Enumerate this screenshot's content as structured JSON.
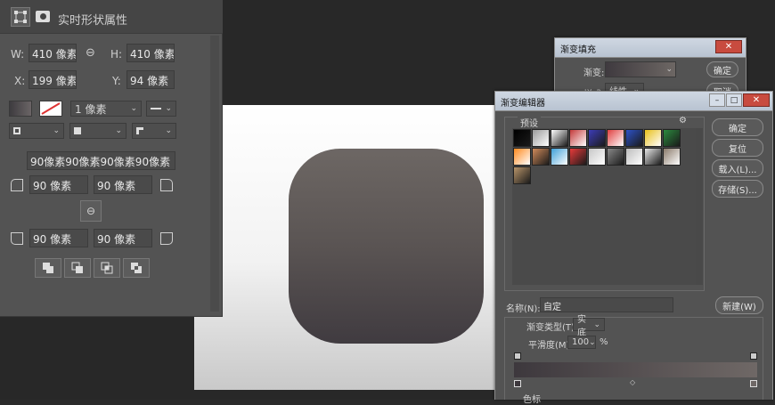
{
  "properties_panel": {
    "title": "实时形状属性",
    "w_label": "W:",
    "w_value": "410 像素",
    "h_label": "H:",
    "h_value": "410 像素",
    "x_label": "X:",
    "x_value": "199 像素",
    "y_label": "Y:",
    "y_value": "94 像素",
    "stroke_width": "1 像素",
    "corner_all": "90像素90像素90像素90像素",
    "corner_tl": "90 像素",
    "corner_tr": "90 像素",
    "corner_bl": "90 像素",
    "corner_br": "90 像素"
  },
  "gradient_fill_dialog": {
    "title": "渐变填充",
    "gradient_label": "渐变:",
    "style_label": "样式:",
    "style_value": "线性",
    "ok": "确定",
    "cancel": "取消"
  },
  "gradient_editor": {
    "title": "渐变编辑器",
    "presets_label": "预设",
    "ok": "确定",
    "reset": "复位",
    "load": "载入(L)...",
    "save": "存储(S)...",
    "name_label": "名称(N):",
    "name_value": "自定",
    "new_button": "新建(W)",
    "gradient_type_label": "渐变类型(T):",
    "gradient_type_value": "实底",
    "smoothness_label": "平滑度(M):",
    "smoothness_value": "100",
    "percent": "%",
    "color_stops_label": "色标",
    "preset_swatches": [
      "#000000",
      "#9a9a9a",
      "#ffffff",
      "#c43a3a",
      "#3d3db8",
      "#e04040",
      "#2d52c8",
      "#e8c01a",
      "#2c8a3e",
      "#ff8a1e",
      "#d08a5a",
      "#3fa0d8",
      "#e83a3a",
      "#c7c7c7",
      "#888888",
      "#bdbdbd",
      "#e8e8e8",
      "#8a7a6a",
      "#b8946a"
    ]
  },
  "colors": {
    "shape_top": "#6d6764",
    "shape_bottom": "#403b40",
    "panel_bg": "#535353"
  }
}
